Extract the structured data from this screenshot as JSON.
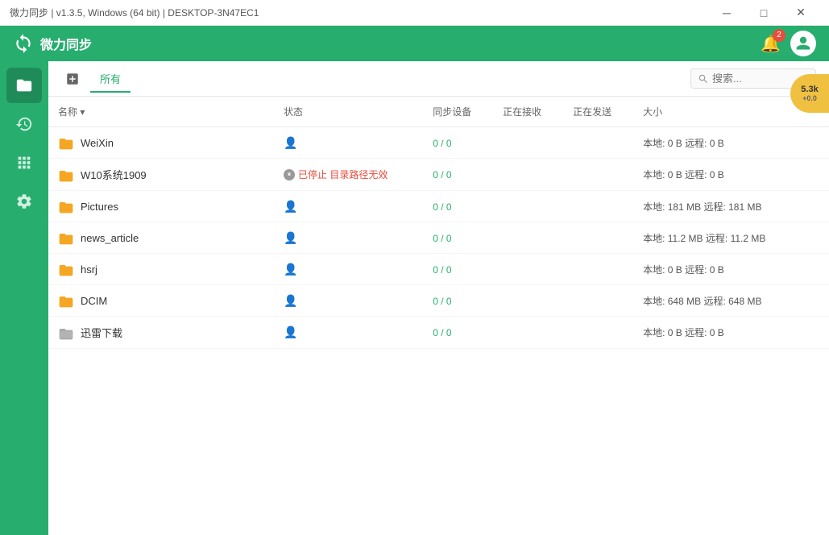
{
  "titlebar": {
    "title": "微力同步 | v1.3.5, Windows (64 bit) | DESKTOP-3N47EC1",
    "minimize": "─",
    "maximize": "□",
    "close": "✕"
  },
  "header": {
    "logo_text": "微力同步",
    "badge_count": "2",
    "search_placeholder": "搜索..."
  },
  "tabs": [
    {
      "id": "all",
      "label": "所有",
      "active": true
    }
  ],
  "columns": [
    {
      "id": "name",
      "label": "名称 ▾"
    },
    {
      "id": "status",
      "label": "状态"
    },
    {
      "id": "sync_device",
      "label": "同步设备"
    },
    {
      "id": "receiving",
      "label": "正在接收"
    },
    {
      "id": "sending",
      "label": "正在发送"
    },
    {
      "id": "size",
      "label": "大小"
    }
  ],
  "rows": [
    {
      "name": "WeiXin",
      "type": "folder",
      "status": "",
      "sync": "0 / 0",
      "receiving": "",
      "sending": "",
      "size": "本地: 0 B 远程: 0 B",
      "special": false
    },
    {
      "name": "W10系统1909",
      "type": "folder",
      "status_text": "已停止 目录路径无效",
      "status_error": true,
      "sync": "0 / 0",
      "receiving": "",
      "sending": "",
      "size": "本地: 0 B 远程: 0 B",
      "special": false
    },
    {
      "name": "Pictures",
      "type": "folder",
      "status": "",
      "sync": "0 / 0",
      "receiving": "",
      "sending": "",
      "size": "本地: 181 MB 远程: 181 MB",
      "special": false
    },
    {
      "name": "news_article",
      "type": "folder",
      "status": "",
      "sync": "0 / 0",
      "receiving": "",
      "sending": "",
      "size": "本地: 11.2 MB 远程: 11.2 MB",
      "special": false
    },
    {
      "name": "hsrj",
      "type": "folder",
      "status": "",
      "sync": "0 / 0",
      "receiving": "",
      "sending": "",
      "size": "本地: 0 B 远程: 0 B",
      "special": false
    },
    {
      "name": "DCIM",
      "type": "folder",
      "status": "",
      "sync": "0 / 0",
      "receiving": "",
      "sending": "",
      "size": "本地: 648 MB 远程: 648 MB",
      "special": false
    },
    {
      "name": "迅雷下载",
      "type": "folder_special",
      "status": "",
      "sync": "0 / 0",
      "receiving": "",
      "sending": "",
      "size": "本地: 0 B 远程: 0 B",
      "special": true
    }
  ],
  "sidebar": {
    "items": [
      {
        "id": "files",
        "icon": "☰",
        "active": true
      },
      {
        "id": "history",
        "icon": "◷"
      },
      {
        "id": "info",
        "icon": "⊞"
      },
      {
        "id": "settings",
        "icon": "⚙"
      }
    ]
  },
  "rate_badge": {
    "value": "5.3k",
    "change": "+0.0"
  }
}
